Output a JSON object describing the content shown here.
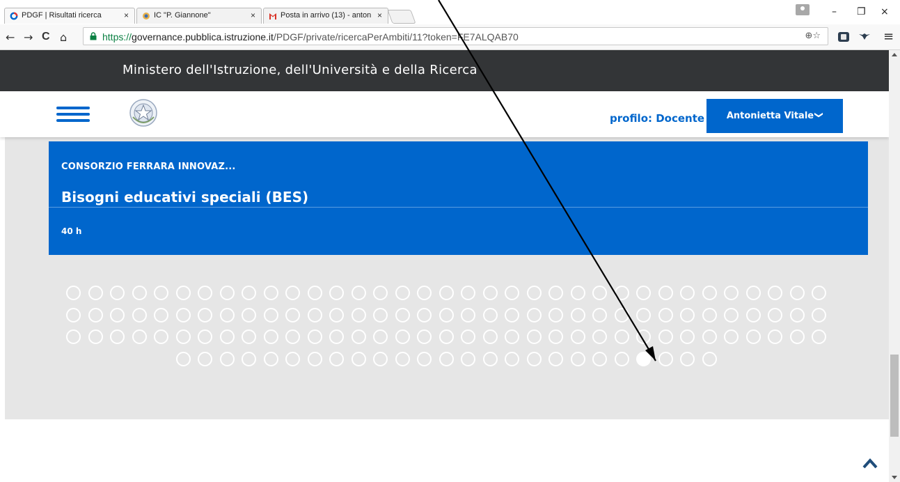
{
  "browser": {
    "tabs": [
      {
        "title": "PDGF | Risultati ricerca",
        "icon": "pdgf-icon",
        "active": true
      },
      {
        "title": "IC \"P. Giannone\"",
        "icon": "school-icon",
        "active": false
      },
      {
        "title": "Posta in arrivo (13) - anton",
        "icon": "gmail-icon",
        "active": false
      }
    ],
    "close_glyph": "×",
    "window_controls": {
      "minimize": "–",
      "restore": "❐",
      "close": "×"
    },
    "nav": {
      "back": "←",
      "forward": "→",
      "reload": "C",
      "home": "⌂"
    },
    "url": {
      "scheme": "https://",
      "host": "governance.pubblica.istruzione.it",
      "path": "/PDGF/private/ricercaPerAmbiti/11?token=FE7ALQAB70"
    },
    "omnibox_icons": "⊕☆",
    "menu_icon": "≡"
  },
  "site": {
    "ministry_title": "Ministero dell'Istruzione, dell'Università e della Ricerca",
    "profile_label": "profilo: Docente",
    "user_name": "Antonietta Vitale",
    "user_chevron": "❯"
  },
  "course": {
    "provider": "CONSORZIO FERRARA INNOVAZ...",
    "title": "Bisogni educativi speciali (BES)",
    "hours": "40 h"
  },
  "pagination": {
    "rows": [
      35,
      35,
      35,
      25
    ],
    "total_dots": 130,
    "active_dot": 127
  },
  "colors": {
    "primary": "#0066cc",
    "dark_bar": "#333537",
    "band": "#e6e6e6"
  }
}
